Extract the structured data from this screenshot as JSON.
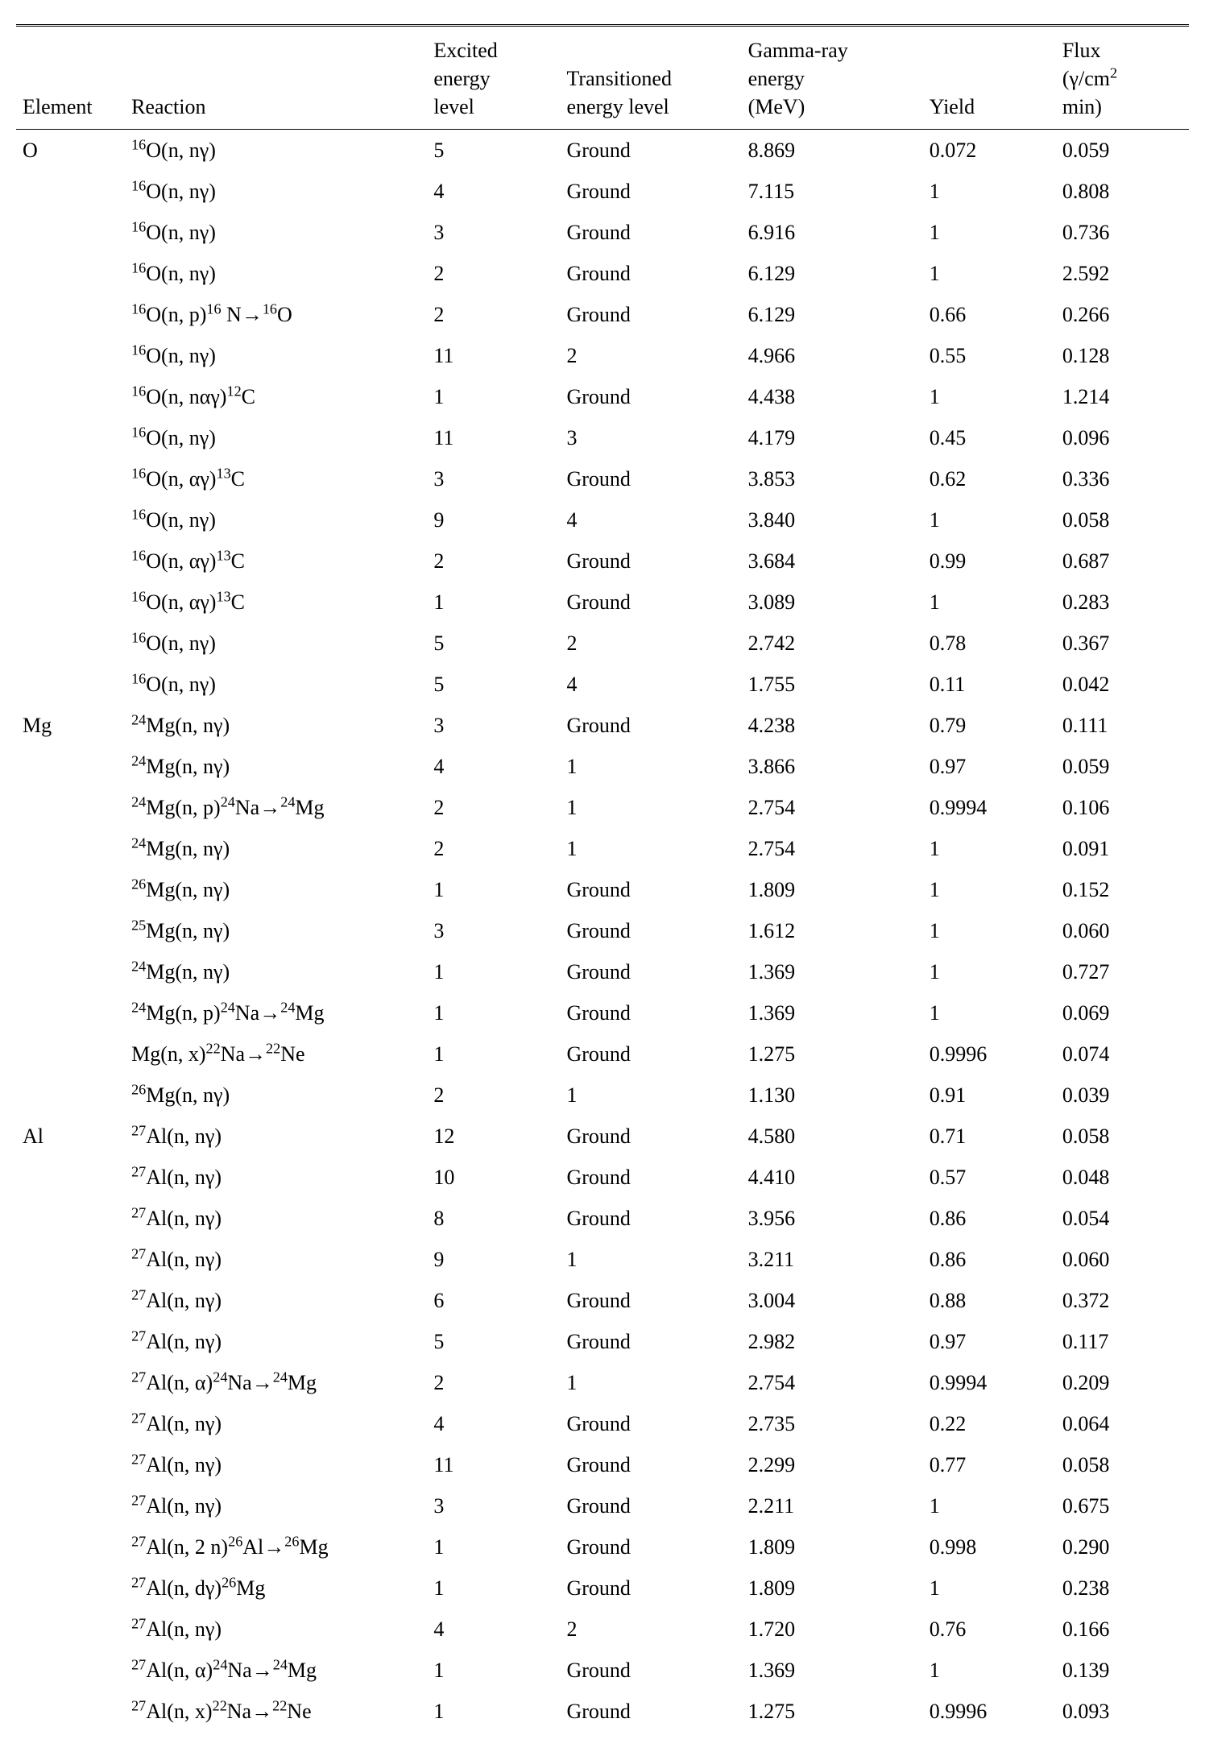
{
  "headers": {
    "element": "Element",
    "reaction": "Reaction",
    "excited": "Excited energy level",
    "transitioned": "Transitioned energy level",
    "energy": "Gamma-ray energy (MeV)",
    "yield": "Yield",
    "flux": "Flux (γ/cm² min)"
  },
  "chart_data": {
    "type": "table",
    "columns": [
      "Element",
      "Reaction",
      "Excited energy level",
      "Transitioned energy level",
      "Gamma-ray energy (MeV)",
      "Yield",
      "Flux (γ/cm² min)"
    ],
    "rows": [
      {
        "element": "O",
        "reaction_html": "<sup>16</sup>O(n, nγ)",
        "excited": "5",
        "transitioned": "Ground",
        "energy": "8.869",
        "yield": "0.072",
        "flux": "0.059"
      },
      {
        "element": "",
        "reaction_html": "<sup>16</sup>O(n, nγ)",
        "excited": "4",
        "transitioned": "Ground",
        "energy": "7.115",
        "yield": "1",
        "flux": "0.808"
      },
      {
        "element": "",
        "reaction_html": "<sup>16</sup>O(n, nγ)",
        "excited": "3",
        "transitioned": "Ground",
        "energy": "6.916",
        "yield": "1",
        "flux": "0.736"
      },
      {
        "element": "",
        "reaction_html": "<sup>16</sup>O(n, nγ)",
        "excited": "2",
        "transitioned": "Ground",
        "energy": "6.129",
        "yield": "1",
        "flux": "2.592"
      },
      {
        "element": "",
        "reaction_html": "<sup>16</sup>O(n, p)<sup>16</sup> N→<sup>16</sup>O",
        "excited": "2",
        "transitioned": "Ground",
        "energy": "6.129",
        "yield": "0.66",
        "flux": "0.266"
      },
      {
        "element": "",
        "reaction_html": "<sup>16</sup>O(n, nγ)",
        "excited": "11",
        "transitioned": "2",
        "energy": "4.966",
        "yield": "0.55",
        "flux": "0.128"
      },
      {
        "element": "",
        "reaction_html": "<sup>16</sup>O(n, nαγ)<sup>12</sup>C",
        "excited": "1",
        "transitioned": "Ground",
        "energy": "4.438",
        "yield": "1",
        "flux": "1.214"
      },
      {
        "element": "",
        "reaction_html": "<sup>16</sup>O(n, nγ)",
        "excited": "11",
        "transitioned": "3",
        "energy": "4.179",
        "yield": "0.45",
        "flux": "0.096"
      },
      {
        "element": "",
        "reaction_html": "<sup>16</sup>O(n, αγ)<sup>13</sup>C",
        "excited": "3",
        "transitioned": "Ground",
        "energy": "3.853",
        "yield": "0.62",
        "flux": "0.336"
      },
      {
        "element": "",
        "reaction_html": "<sup>16</sup>O(n, nγ)",
        "excited": "9",
        "transitioned": "4",
        "energy": "3.840",
        "yield": "1",
        "flux": "0.058"
      },
      {
        "element": "",
        "reaction_html": "<sup>16</sup>O(n, αγ)<sup>13</sup>C",
        "excited": "2",
        "transitioned": "Ground",
        "energy": "3.684",
        "yield": "0.99",
        "flux": "0.687"
      },
      {
        "element": "",
        "reaction_html": "<sup>16</sup>O(n, αγ)<sup>13</sup>C",
        "excited": "1",
        "transitioned": "Ground",
        "energy": "3.089",
        "yield": "1",
        "flux": "0.283"
      },
      {
        "element": "",
        "reaction_html": "<sup>16</sup>O(n, nγ)",
        "excited": "5",
        "transitioned": "2",
        "energy": "2.742",
        "yield": "0.78",
        "flux": "0.367"
      },
      {
        "element": "",
        "reaction_html": "<sup>16</sup>O(n, nγ)",
        "excited": "5",
        "transitioned": "4",
        "energy": "1.755",
        "yield": "0.11",
        "flux": "0.042"
      },
      {
        "element": "Mg",
        "reaction_html": "<sup>24</sup>Mg(n, nγ)",
        "excited": "3",
        "transitioned": "Ground",
        "energy": "4.238",
        "yield": "0.79",
        "flux": "0.111"
      },
      {
        "element": "",
        "reaction_html": "<sup>24</sup>Mg(n, nγ)",
        "excited": "4",
        "transitioned": "1",
        "energy": "3.866",
        "yield": "0.97",
        "flux": "0.059"
      },
      {
        "element": "",
        "reaction_html": "<sup>24</sup>Mg(n, p)<sup>24</sup>Na→<sup>24</sup>Mg",
        "excited": "2",
        "transitioned": "1",
        "energy": "2.754",
        "yield": "0.9994",
        "flux": "0.106"
      },
      {
        "element": "",
        "reaction_html": "<sup>24</sup>Mg(n, nγ)",
        "excited": "2",
        "transitioned": "1",
        "energy": "2.754",
        "yield": "1",
        "flux": "0.091"
      },
      {
        "element": "",
        "reaction_html": "<sup>26</sup>Mg(n, nγ)",
        "excited": "1",
        "transitioned": "Ground",
        "energy": "1.809",
        "yield": "1",
        "flux": "0.152"
      },
      {
        "element": "",
        "reaction_html": "<sup>25</sup>Mg(n, nγ)",
        "excited": "3",
        "transitioned": "Ground",
        "energy": "1.612",
        "yield": "1",
        "flux": "0.060"
      },
      {
        "element": "",
        "reaction_html": "<sup>24</sup>Mg(n, nγ)",
        "excited": "1",
        "transitioned": "Ground",
        "energy": "1.369",
        "yield": "1",
        "flux": "0.727"
      },
      {
        "element": "",
        "reaction_html": "<sup>24</sup>Mg(n, p)<sup>24</sup>Na→<sup>24</sup>Mg",
        "excited": "1",
        "transitioned": "Ground",
        "energy": "1.369",
        "yield": "1",
        "flux": "0.069"
      },
      {
        "element": "",
        "reaction_html": "Mg(n, x)<sup>22</sup>Na→<sup>22</sup>Ne",
        "excited": "1",
        "transitioned": "Ground",
        "energy": "1.275",
        "yield": "0.9996",
        "flux": "0.074"
      },
      {
        "element": "",
        "reaction_html": "<sup>26</sup>Mg(n, nγ)",
        "excited": "2",
        "transitioned": "1",
        "energy": "1.130",
        "yield": "0.91",
        "flux": "0.039"
      },
      {
        "element": "Al",
        "reaction_html": "<sup>27</sup>Al(n, nγ)",
        "excited": "12",
        "transitioned": "Ground",
        "energy": "4.580",
        "yield": "0.71",
        "flux": "0.058"
      },
      {
        "element": "",
        "reaction_html": "<sup>27</sup>Al(n, nγ)",
        "excited": "10",
        "transitioned": "Ground",
        "energy": "4.410",
        "yield": "0.57",
        "flux": "0.048"
      },
      {
        "element": "",
        "reaction_html": "<sup>27</sup>Al(n, nγ)",
        "excited": "8",
        "transitioned": "Ground",
        "energy": "3.956",
        "yield": "0.86",
        "flux": "0.054"
      },
      {
        "element": "",
        "reaction_html": "<sup>27</sup>Al(n, nγ)",
        "excited": "9",
        "transitioned": "1",
        "energy": "3.211",
        "yield": "0.86",
        "flux": "0.060"
      },
      {
        "element": "",
        "reaction_html": "<sup>27</sup>Al(n, nγ)",
        "excited": "6",
        "transitioned": "Ground",
        "energy": "3.004",
        "yield": "0.88",
        "flux": "0.372"
      },
      {
        "element": "",
        "reaction_html": "<sup>27</sup>Al(n, nγ)",
        "excited": "5",
        "transitioned": "Ground",
        "energy": "2.982",
        "yield": "0.97",
        "flux": "0.117"
      },
      {
        "element": "",
        "reaction_html": "<sup>27</sup>Al(n, α)<sup>24</sup>Na→<sup>24</sup>Mg",
        "excited": "2",
        "transitioned": "1",
        "energy": "2.754",
        "yield": "0.9994",
        "flux": "0.209"
      },
      {
        "element": "",
        "reaction_html": "<sup>27</sup>Al(n, nγ)",
        "excited": "4",
        "transitioned": "Ground",
        "energy": "2.735",
        "yield": "0.22",
        "flux": "0.064"
      },
      {
        "element": "",
        "reaction_html": "<sup>27</sup>Al(n, nγ)",
        "excited": "11",
        "transitioned": "Ground",
        "energy": "2.299",
        "yield": "0.77",
        "flux": "0.058"
      },
      {
        "element": "",
        "reaction_html": "<sup>27</sup>Al(n, nγ)",
        "excited": "3",
        "transitioned": "Ground",
        "energy": "2.211",
        "yield": "1",
        "flux": "0.675"
      },
      {
        "element": "",
        "reaction_html": "<sup>27</sup>Al(n, 2 n)<sup>26</sup>Al→<sup>26</sup>Mg",
        "excited": "1",
        "transitioned": "Ground",
        "energy": "1.809",
        "yield": "0.998",
        "flux": "0.290"
      },
      {
        "element": "",
        "reaction_html": "<sup>27</sup>Al(n, dγ)<sup>26</sup>Mg",
        "excited": "1",
        "transitioned": "Ground",
        "energy": "1.809",
        "yield": "1",
        "flux": "0.238"
      },
      {
        "element": "",
        "reaction_html": "<sup>27</sup>Al(n, nγ)",
        "excited": "4",
        "transitioned": "2",
        "energy": "1.720",
        "yield": "0.76",
        "flux": "0.166"
      },
      {
        "element": "",
        "reaction_html": "<sup>27</sup>Al(n, α)<sup>24</sup>Na→<sup>24</sup>Mg",
        "excited": "1",
        "transitioned": "Ground",
        "energy": "1.369",
        "yield": "1",
        "flux": "0.139"
      },
      {
        "element": "",
        "reaction_html": "<sup>27</sup>Al(n, x)<sup>22</sup>Na→<sup>22</sup>Ne",
        "excited": "1",
        "transitioned": "Ground",
        "energy": "1.275",
        "yield": "0.9996",
        "flux": "0.093"
      }
    ]
  }
}
